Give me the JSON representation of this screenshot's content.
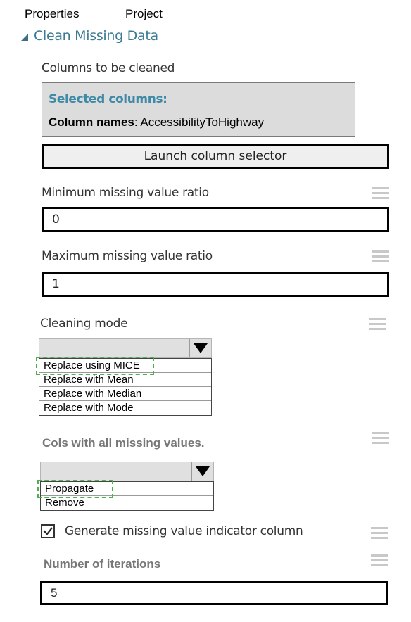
{
  "tabs": [
    {
      "label": "Properties"
    },
    {
      "label": "Project"
    }
  ],
  "section": {
    "title": "Clean Missing Data",
    "expanded": true
  },
  "columns_to_clean": {
    "label": "Columns to be cleaned",
    "selected_title": "Selected columns:",
    "column_names_label": "Column names",
    "column_names_value": ": AccessibilityToHighway",
    "launch_button": "Launch column selector"
  },
  "min_ratio": {
    "label": "Minimum missing value ratio",
    "value": "0"
  },
  "max_ratio": {
    "label": "Maximum missing value ratio",
    "value": "1"
  },
  "cleaning_mode": {
    "label": "Cleaning mode",
    "selected": "",
    "options": [
      {
        "label": "Replace using MICE",
        "highlighted": true
      },
      {
        "label": "Replace with Mean"
      },
      {
        "label": "Replace with Median"
      },
      {
        "label": "Replace with Mode"
      }
    ]
  },
  "cols_all_missing": {
    "label": "Cols with all missing values.",
    "selected": "",
    "options": [
      {
        "label": "Propagate",
        "highlighted": true
      },
      {
        "label": "Remove"
      }
    ]
  },
  "indicator_column": {
    "label": "Generate missing value indicator column",
    "checked": true
  },
  "iterations": {
    "label": "Number of iterations",
    "value": "5"
  },
  "colors": {
    "accent": "#3d7b93",
    "highlight_dash": "#4caf50"
  }
}
